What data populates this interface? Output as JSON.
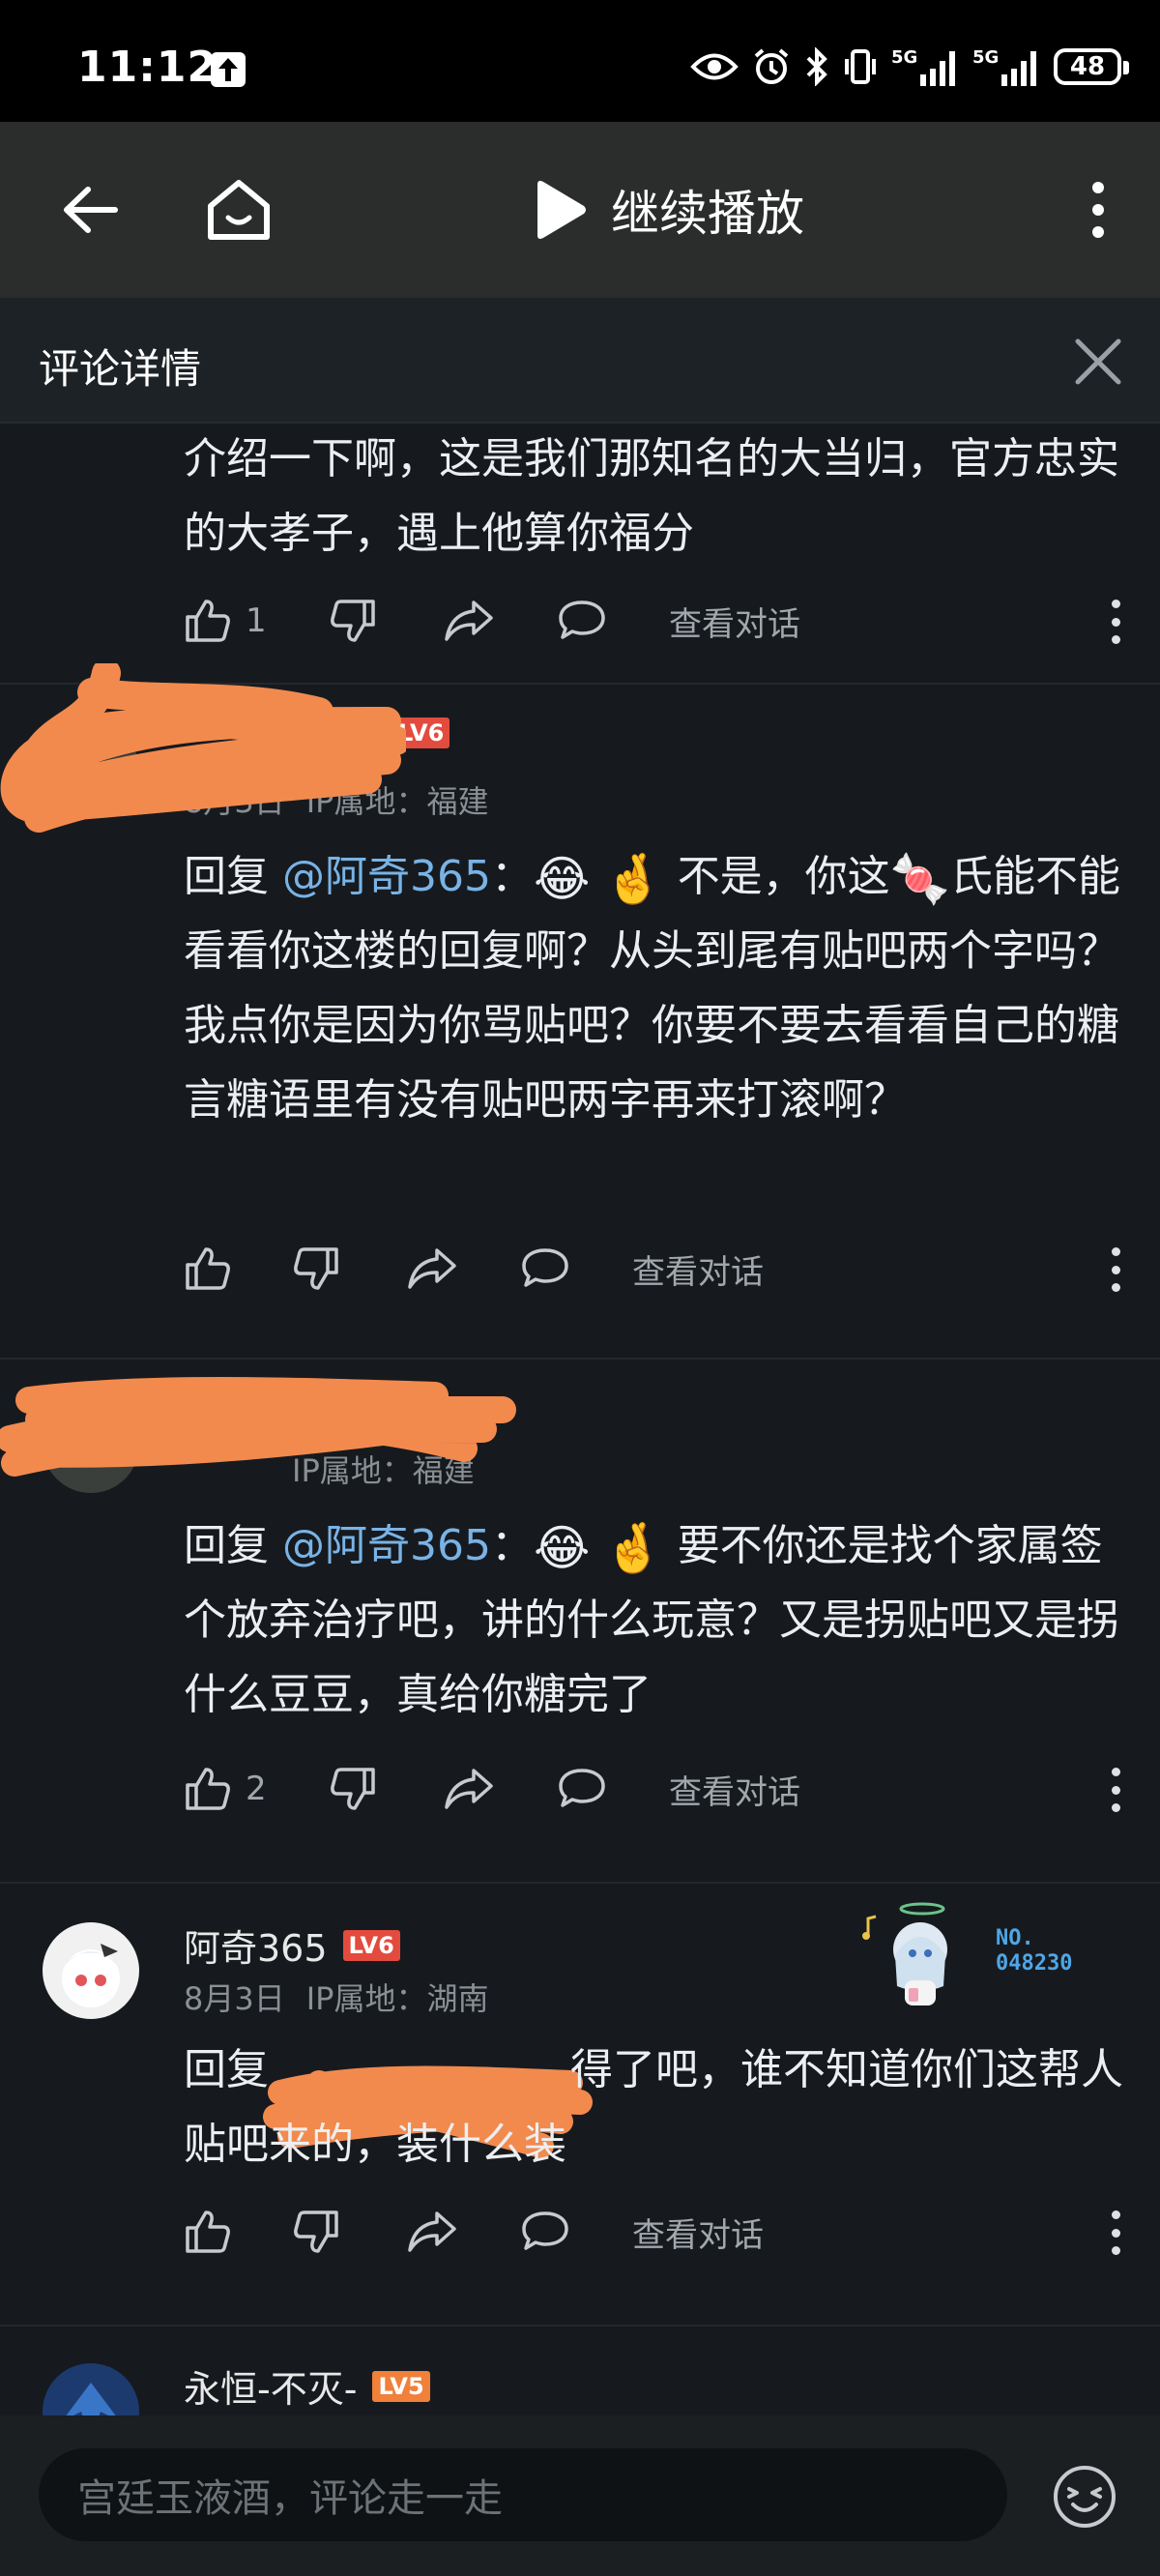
{
  "status_bar": {
    "time": "11:12",
    "battery": "48",
    "network": [
      "5G",
      "5G"
    ]
  },
  "top_bar": {
    "continue_label": "继续播放",
    "icons": [
      "back-arrow-icon",
      "home-icon",
      "play-icon",
      "more-vertical-icon"
    ]
  },
  "section": {
    "title": "评论详情",
    "close_icon": "close-icon"
  },
  "comments": [
    {
      "body": "介绍一下啊，这是我们那知名的大当归，官方忠实的大孝子，遇上他算你福分",
      "likes": "1",
      "view_label": "查看对话"
    },
    {
      "level": "LV6",
      "date": "8月3日",
      "ip": "IP属地：福建",
      "reply_prefix": "回复",
      "mention": "@阿奇365",
      "colon": "：",
      "emoji_1": "😂",
      "emoji_2": "🤞",
      "body_a": "不是，你这",
      "emoji_3": "🍬",
      "body_b": "氏能不能看看你这楼的回复啊？从头到尾有贴吧两个字吗？我点你是因为你骂贴吧？你要不要去看看自己的糖言糖语里有没有贴吧两字再来打滚啊？",
      "likes": "",
      "view_label": "查看对话"
    },
    {
      "ip": "IP属地：福建",
      "reply_prefix": "回复",
      "mention": "@阿奇365",
      "colon": "：",
      "emoji_1": "😂",
      "emoji_2": "🤞",
      "body_a": "要不你还是找个家属签个放弃治疗吧，讲的什么玩意？又是拐贴吧又是拐什么豆豆，真给你糖完了",
      "likes": "2",
      "view_label": "查看对话"
    },
    {
      "username": "阿奇365",
      "level": "LV6",
      "date": "8月3日",
      "ip": "IP属地：湖南",
      "badge_label": "NO.",
      "badge_number": "048230",
      "reply_prefix": "回复",
      "body_a": "得了吧，谁不知道你们这帮人贴吧来的，装什么装",
      "likes": "",
      "view_label": "查看对话"
    },
    {
      "username": "永恒-不灭-",
      "level": "LV5"
    }
  ],
  "bottom_bar": {
    "input_placeholder": "宫廷玉液酒，评论走一走",
    "emoji_icon": "emoji-face-icon"
  },
  "colors": {
    "background": "#161a1e",
    "top_bar": "#2a2d2c",
    "mention": "#79b3e6",
    "level_badge": "#e24b3d",
    "scribble": "#f28a4e"
  }
}
